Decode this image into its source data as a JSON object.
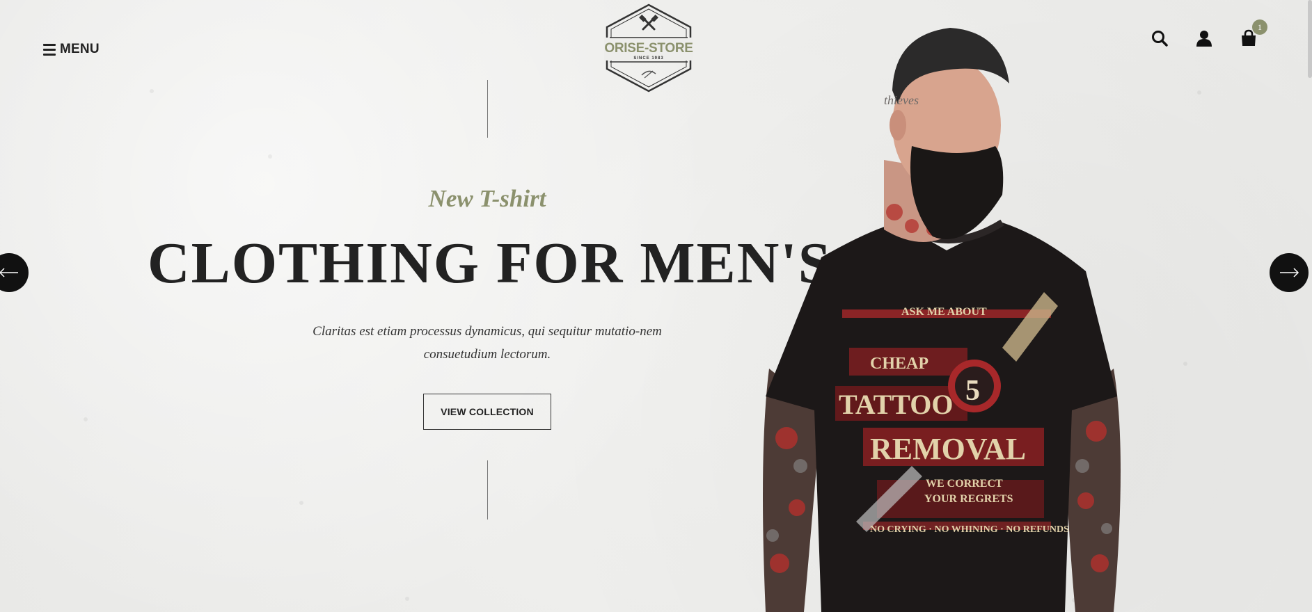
{
  "header": {
    "menu_label": "MENU",
    "logo": {
      "brand": "ORISE-STORE",
      "tagline": "SINCE 1983"
    },
    "cart_count": "1",
    "icons": [
      "search-icon",
      "user-icon",
      "shopping-bag-icon"
    ]
  },
  "hero": {
    "subtitle": "New T-shirt",
    "title": "CLOTHING FOR MEN'S",
    "description": "Claritas est etiam processus dynamicus, qui sequitur mutatio-nem consuetudium lectorum.",
    "button_label": "VIEW COLLECTION"
  },
  "colors": {
    "accent": "#8b916d",
    "text": "#222222",
    "background": "#ededeb",
    "arrow_bg": "#111111"
  }
}
